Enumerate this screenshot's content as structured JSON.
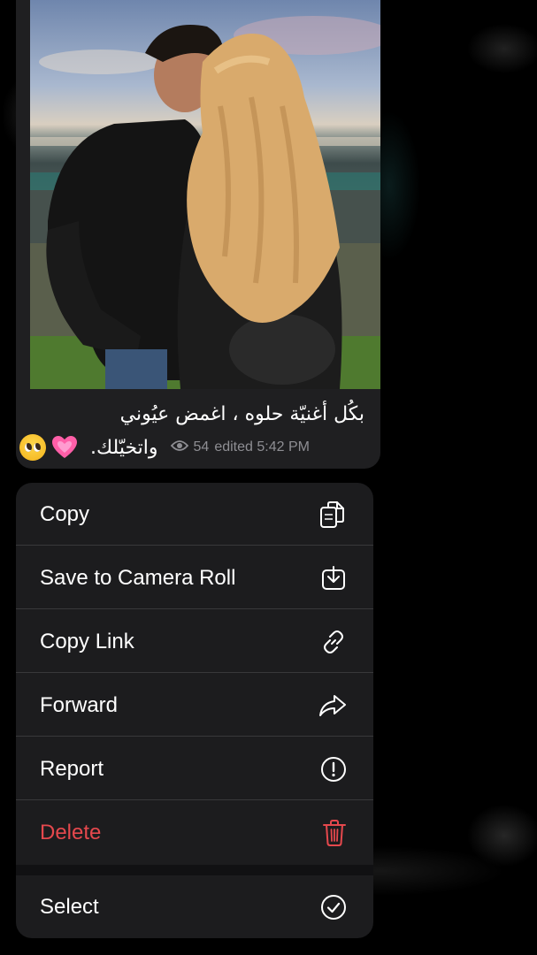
{
  "message": {
    "caption_line1": "بكُل أغنيّة حلوه ، اغمض عيُوني",
    "caption_line2": "واتخيّلك.",
    "emojis": [
      "pleading-face",
      "growing-heart"
    ],
    "views": "54",
    "edited_time": "edited 5:42 PM"
  },
  "menu": {
    "items": [
      {
        "label": "Copy",
        "icon": "copy-icon"
      },
      {
        "label": "Save to Camera Roll",
        "icon": "download-icon"
      },
      {
        "label": "Copy Link",
        "icon": "link-icon"
      },
      {
        "label": "Forward",
        "icon": "forward-icon"
      },
      {
        "label": "Report",
        "icon": "report-icon"
      },
      {
        "label": "Delete",
        "icon": "trash-icon",
        "color": "#e5484d"
      },
      {
        "label": "Select",
        "icon": "select-check-icon"
      }
    ]
  },
  "colors": {
    "background": "#000000",
    "menu_bg": "#1c1c1e",
    "bubble_bg": "#1f1f21",
    "destructive": "#e5484d",
    "meta_text": "#8e8e93"
  }
}
